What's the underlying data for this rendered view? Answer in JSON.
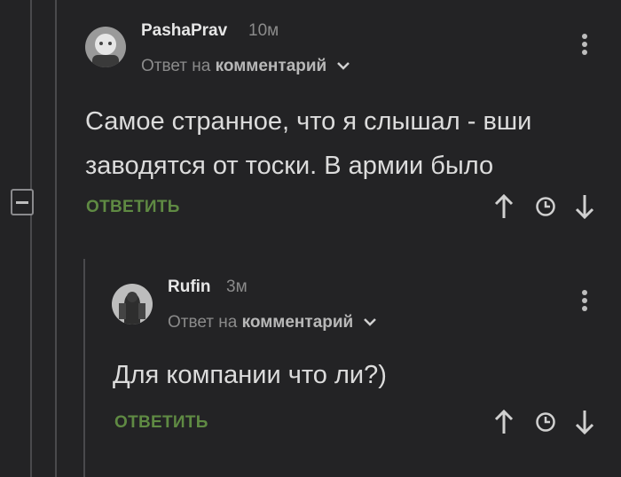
{
  "comments": [
    {
      "author": "PashaPrav",
      "time_ago": "10м",
      "reply_prefix": "Ответ на",
      "reply_target": "комментарий",
      "text_lines": [
        "Самое странное, что я слышал - вши",
        "заводятся от тоски. В армии было"
      ],
      "reply_button": "ОТВЕТИТЬ"
    },
    {
      "author": "Rufin",
      "time_ago": "3м",
      "reply_prefix": "Ответ на",
      "reply_target": "комментарий",
      "text_lines": [
        "Для компании что ли?)"
      ],
      "reply_button": "ОТВЕТИТЬ"
    }
  ],
  "colors": {
    "background": "#232325",
    "accent_green": "#5f8a43",
    "muted_text": "#8b8b8b"
  },
  "icons": [
    "collapse-minus-icon",
    "more-dots-icon",
    "chevron-down-icon",
    "upvote-arrow-icon",
    "clock-icon",
    "downvote-arrow-icon"
  ]
}
